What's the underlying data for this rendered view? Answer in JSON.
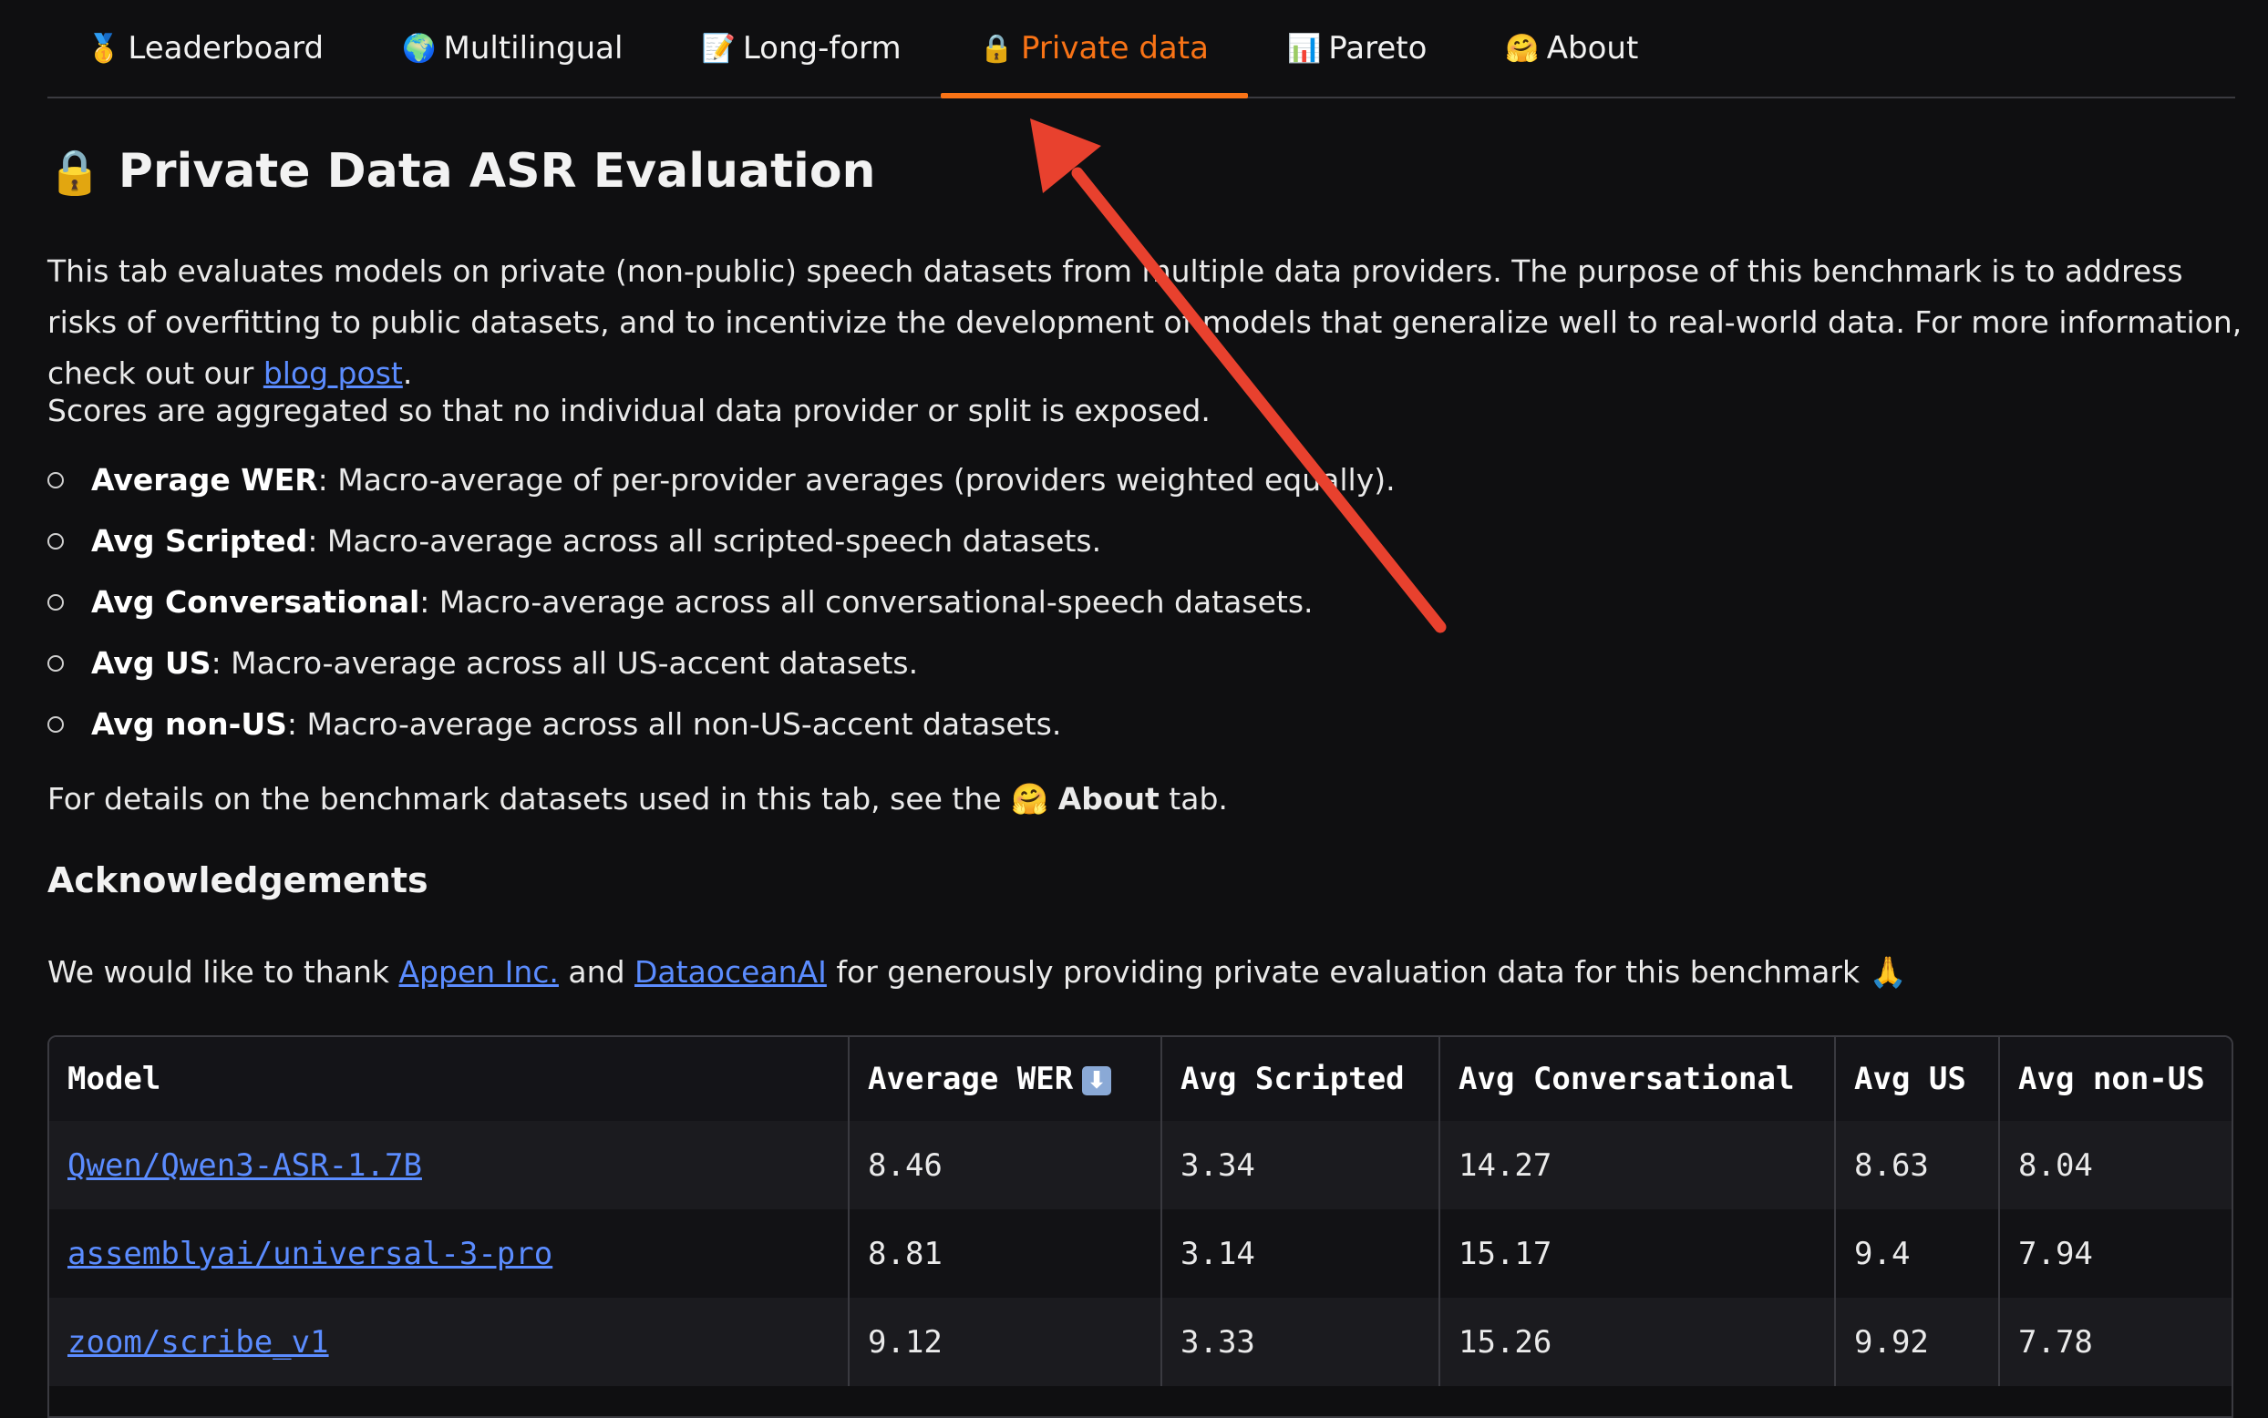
{
  "tabs": [
    {
      "emoji": "🥇",
      "label": "Leaderboard",
      "active": false
    },
    {
      "emoji": "🌍",
      "label": "Multilingual",
      "active": false
    },
    {
      "emoji": "📝",
      "label": "Long-form",
      "active": false
    },
    {
      "emoji": "🔒",
      "label": "Private data",
      "active": true
    },
    {
      "emoji": "📊",
      "label": "Pareto",
      "active": false
    },
    {
      "emoji": "🤗",
      "label": "About",
      "active": false
    }
  ],
  "heading": {
    "emoji": "🔒",
    "title": "Private Data ASR Evaluation"
  },
  "intro": {
    "text_before_link": "This tab evaluates models on private (non-public) speech datasets from multiple data providers. The purpose of this benchmark is to address risks of overfitting to public datasets, and to incentivize the development of models that generalize well to real-world data. For more information, check out our ",
    "link": "blog post",
    "text_after_link": "."
  },
  "aggregation_note": "Scores are aggregated so that no individual data provider or split is exposed.",
  "bullets": [
    {
      "term": "Average WER",
      "desc": ": Macro-average of per-provider averages (providers weighted equally)."
    },
    {
      "term": "Avg Scripted",
      "desc": ": Macro-average across all scripted-speech datasets."
    },
    {
      "term": "Avg Conversational",
      "desc": ": Macro-average across all conversational-speech datasets."
    },
    {
      "term": "Avg US",
      "desc": ": Macro-average across all US-accent datasets."
    },
    {
      "term": "Avg non-US",
      "desc": ": Macro-average across all non-US-accent datasets."
    }
  ],
  "details": {
    "before": "For details on the benchmark datasets used in this tab, see the ",
    "emoji": "🤗",
    "bold": "About",
    "after": " tab."
  },
  "ack": {
    "heading": "Acknowledgements",
    "before": "We would like to thank ",
    "link1": "Appen Inc.",
    "middle": " and ",
    "link2": "DataoceanAI",
    "after": " for generously providing private evaluation data for this benchmark ",
    "emoji": "🙏"
  },
  "table": {
    "columns": [
      "Model",
      "Average WER",
      "Avg Scripted",
      "Avg Conversational",
      "Avg US",
      "Avg non-US"
    ],
    "sort_icon": "⬇",
    "rows": [
      [
        "Qwen/Qwen3-ASR-1.7B",
        "8.46",
        "3.34",
        "14.27",
        "8.63",
        "8.04"
      ],
      [
        "assemblyai/universal-3-pro",
        "8.81",
        "3.14",
        "15.17",
        "9.4",
        "7.94"
      ],
      [
        "zoom/scribe_v1",
        "9.12",
        "3.33",
        "15.26",
        "9.92",
        "7.78"
      ]
    ]
  },
  "colors": {
    "accent": "#f97316",
    "link": "#5b8cff",
    "annotation_arrow": "#e8412e"
  }
}
